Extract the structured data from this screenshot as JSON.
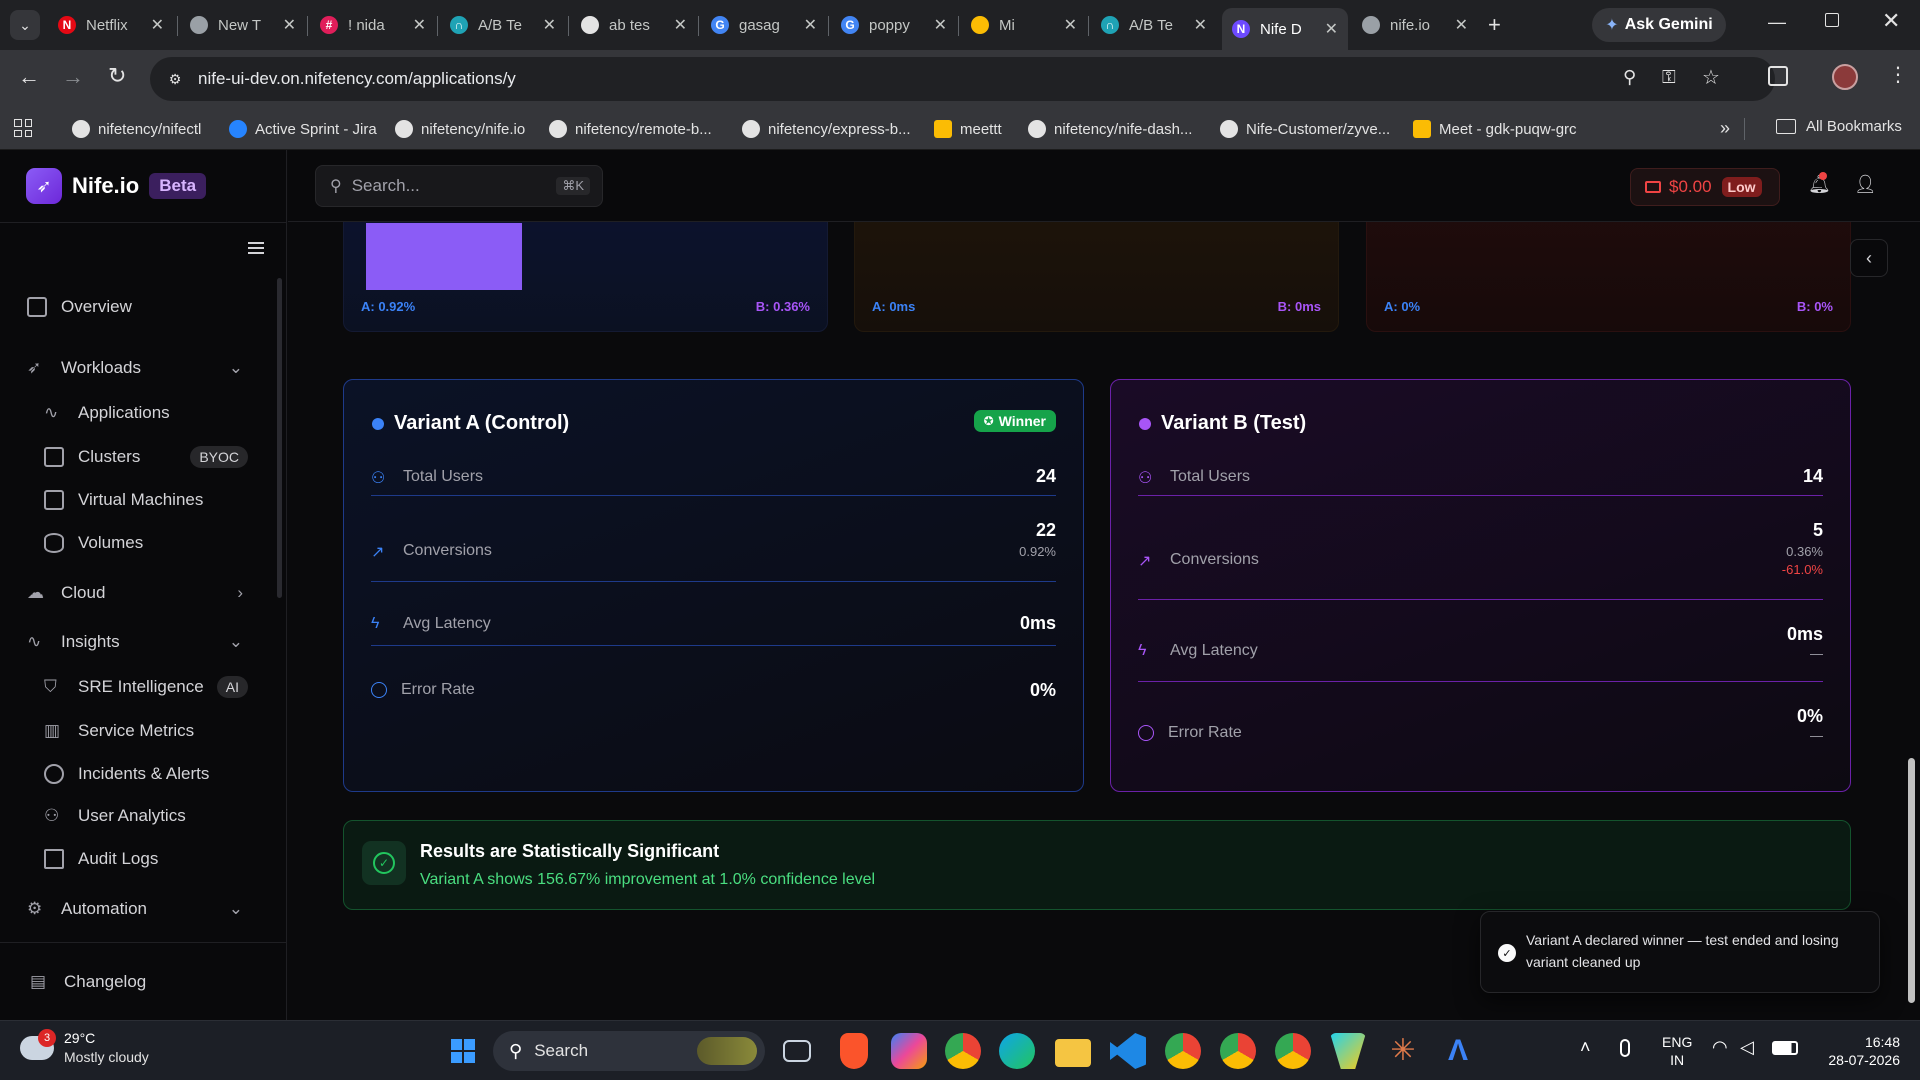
{
  "browser": {
    "tabs": [
      {
        "title": "Netflix",
        "fav": "N",
        "color": "#e50914"
      },
      {
        "title": "New T",
        "fav": "",
        "color": "#9aa0a6"
      },
      {
        "title": "! nida",
        "fav": "#",
        "color": "#e01e5a"
      },
      {
        "title": "A/B Te",
        "fav": "∩",
        "color": "#1fa3b5"
      },
      {
        "title": "ab tes",
        "fav": "",
        "color": "#e3e3e3"
      },
      {
        "title": "gasag",
        "fav": "G",
        "color": "#4285f4"
      },
      {
        "title": "poppy",
        "fav": "G",
        "color": "#4285f4"
      },
      {
        "title": "Mi",
        "fav": "",
        "color": "#fbbc04"
      },
      {
        "title": "A/B Te",
        "fav": "∩",
        "color": "#1fa3b5"
      },
      {
        "title": "Nife D",
        "fav": "N",
        "color": "#6d4aff"
      },
      {
        "title": "nife.io",
        "fav": "",
        "color": "#9aa0a6"
      }
    ],
    "ask_gemini": "Ask Gemini",
    "url": "nife-ui-dev.on.nifetency.com/applications/y",
    "bookmarks": [
      "nifetency/nifectl",
      "Active Sprint - Jira",
      "nifetency/nife.io",
      "nifetency/remote-b...",
      "nifetency/express-b...",
      "meettt",
      "nifetency/nife-dash...",
      "Nife-Customer/zyve...",
      "Meet - gdk-puqw-grc"
    ],
    "all_bookmarks": "All Bookmarks"
  },
  "app": {
    "brand": "Nife.io",
    "beta": "Beta",
    "search_placeholder": "Search...",
    "search_shortcut": "⌘K",
    "balance": "$0.00",
    "balance_badge": "Low",
    "nav": {
      "overview": "Overview",
      "workloads": "Workloads",
      "applications": "Applications",
      "clusters": "Clusters",
      "clusters_badge": "BYOC",
      "virtual_machines": "Virtual Machines",
      "volumes": "Volumes",
      "cloud": "Cloud",
      "insights": "Insights",
      "sre": "SRE Intelligence",
      "sre_badge": "AI",
      "service_metrics": "Service Metrics",
      "incidents": "Incidents & Alerts",
      "user_analytics": "User Analytics",
      "audit_logs": "Audit Logs",
      "automation": "Automation",
      "changelog": "Changelog"
    },
    "summary": [
      {
        "a": "A: 0.92%",
        "b": "B: 0.36%"
      },
      {
        "a": "A: 0ms",
        "b": "B: 0ms"
      },
      {
        "a": "A: 0%",
        "b": "B: 0%"
      }
    ],
    "variant_a": {
      "title": "Variant A (Control)",
      "winner": "Winner",
      "total_users_label": "Total Users",
      "total_users": "24",
      "conversions_label": "Conversions",
      "conversions": "22",
      "conversions_rate": "0.92%",
      "latency_label": "Avg Latency",
      "latency": "0ms",
      "error_label": "Error Rate",
      "error": "0%"
    },
    "variant_b": {
      "title": "Variant B (Test)",
      "total_users_label": "Total Users",
      "total_users": "14",
      "conversions_label": "Conversions",
      "conversions": "5",
      "conversions_rate": "0.36%",
      "conversions_delta": "-61.0%",
      "latency_label": "Avg Latency",
      "latency": "0ms",
      "latency_delta": "—",
      "error_label": "Error Rate",
      "error": "0%",
      "error_delta": "—"
    },
    "significance": {
      "title": "Results are Statistically Significant",
      "detail": "Variant A shows 156.67% improvement at 1.0% confidence level"
    },
    "toast": "Variant A declared winner — test ended and losing variant cleaned up"
  },
  "taskbar": {
    "weather_temp": "29°C",
    "weather_desc": "Mostly cloudy",
    "weather_badge": "3",
    "search": "Search",
    "lang1": "ENG",
    "lang2": "IN",
    "time": "16:48",
    "date": "28-07-2026"
  },
  "colors": {
    "accent_a": "#3b82f6",
    "accent_b": "#a855f7",
    "success": "#22c55e",
    "danger": "#ef4444"
  }
}
